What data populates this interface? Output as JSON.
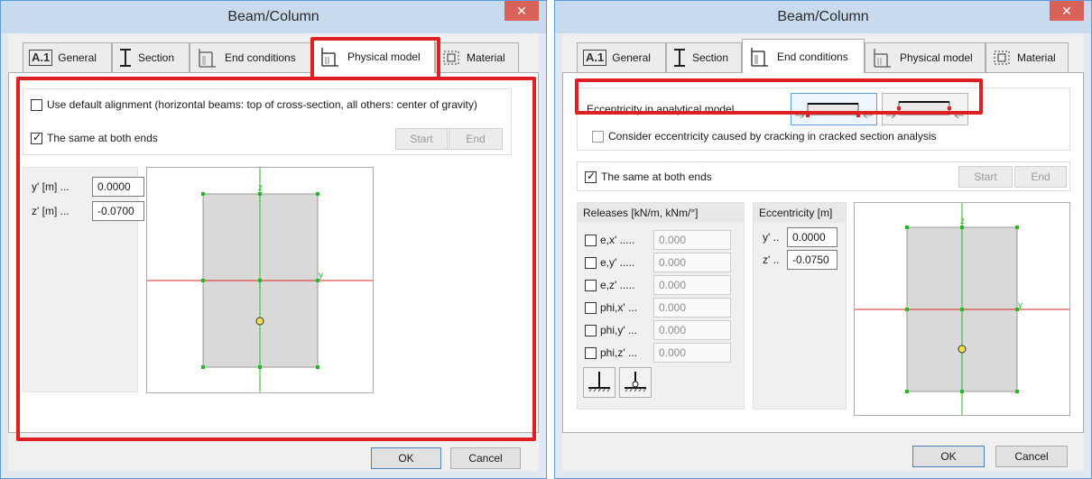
{
  "left_dialog": {
    "title": "Beam/Column",
    "close_glyph": "✕",
    "tabs": [
      {
        "icon": "a1-icon",
        "icon_text": "A.1",
        "label": "General"
      },
      {
        "icon": "i-beam-icon",
        "label": "Section"
      },
      {
        "icon": "end-conditions-icon",
        "label": "End conditions"
      },
      {
        "icon": "physical-model-icon",
        "label": "Physical model"
      },
      {
        "icon": "material-icon",
        "label": "Material"
      }
    ],
    "active_tab": "Physical model",
    "default_alignment_label": "Use default alignment (horizontal beams: top of cross-section, all others: center of gravity)",
    "default_alignment_checked": false,
    "same_at_both_ends_label": "The same at both ends",
    "same_at_both_ends_checked": true,
    "start_label": "Start",
    "end_label": "End",
    "y_label": "y' [m] ...",
    "y_value": "0.0000",
    "z_label": "z' [m] ...",
    "z_value": "-0.0700",
    "axis_z_label": "z",
    "axis_y_label": "y",
    "ok_label": "OK",
    "cancel_label": "Cancel"
  },
  "right_dialog": {
    "title": "Beam/Column",
    "close_glyph": "✕",
    "tabs": [
      {
        "icon": "a1-icon",
        "icon_text": "A.1",
        "label": "General"
      },
      {
        "icon": "i-beam-icon",
        "label": "Section"
      },
      {
        "icon": "end-conditions-icon",
        "label": "End conditions"
      },
      {
        "icon": "physical-model-icon",
        "label": "Physical model"
      },
      {
        "icon": "material-icon",
        "label": "Material"
      }
    ],
    "active_tab": "End conditions",
    "eccentricity_model_label": "Eccentricity in analytical model ..........",
    "cracking_label": "Consider eccentricity caused by cracking in cracked section analysis",
    "cracking_checked": false,
    "same_at_both_ends_label": "The same at both ends",
    "same_at_both_ends_checked": true,
    "start_label": "Start",
    "end_label": "End",
    "releases_header": "Releases [kN/m, kNm/°]",
    "releases": [
      {
        "label": "e,x' .....",
        "value": "0.000",
        "checked": false
      },
      {
        "label": "e,y' .....",
        "value": "0.000",
        "checked": false
      },
      {
        "label": "e,z' .....",
        "value": "0.000",
        "checked": false
      },
      {
        "label": "phi,x' ...",
        "value": "0.000",
        "checked": false
      },
      {
        "label": "phi,y' ...",
        "value": "0.000",
        "checked": false
      },
      {
        "label": "phi,z' ...",
        "value": "0.000",
        "checked": false
      }
    ],
    "support_buttons": [
      "fixed-support-icon",
      "pinned-support-icon"
    ],
    "eccentricity_header": "Eccentricity [m]",
    "ecc_y_label": "y' ..",
    "ecc_y_value": "0.0000",
    "ecc_z_label": "z' ..",
    "ecc_z_value": "-0.0750",
    "axis_z_label": "z",
    "axis_y_label": "y",
    "ok_label": "OK",
    "cancel_label": "Cancel"
  },
  "colors": {
    "highlight": "#e02020",
    "axis_green": "#22bb22",
    "axis_red": "#dd2222",
    "center_point": "#f5e04a",
    "close_button": "#d8615a"
  }
}
